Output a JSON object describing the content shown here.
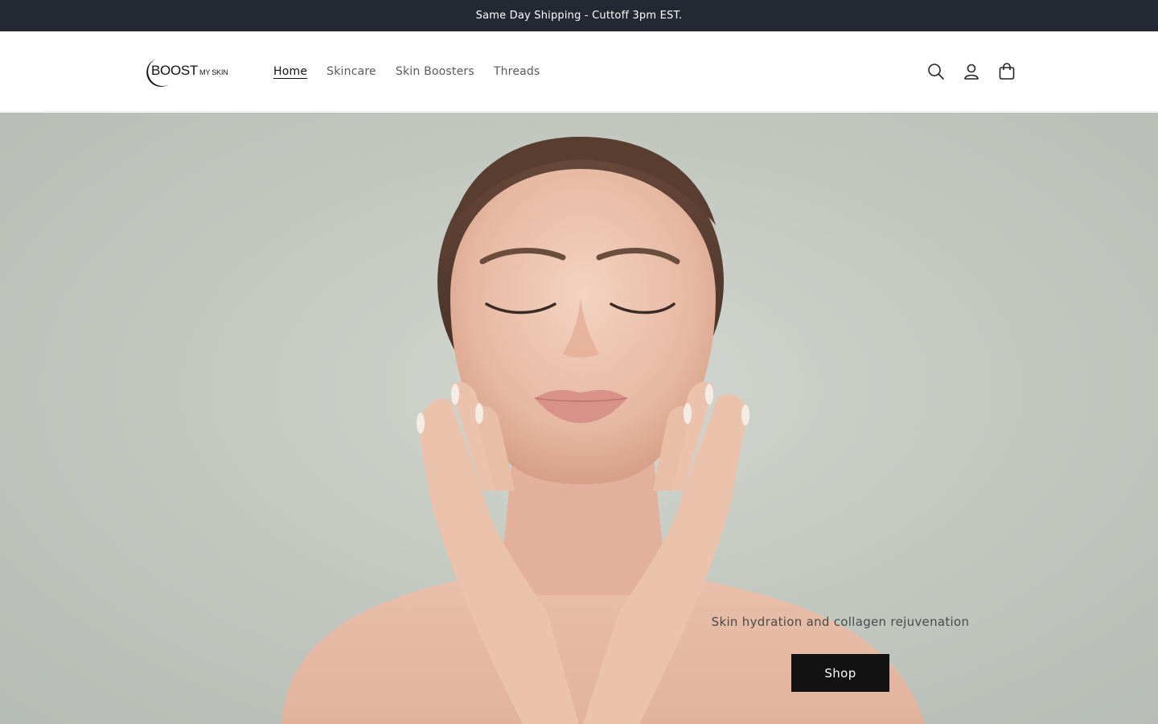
{
  "announcement": {
    "text": "Same Day Shipping - Cuttoff 3pm EST."
  },
  "brand": {
    "logo_main": "BOOST",
    "logo_sub": "MY SKIN"
  },
  "nav": {
    "items": [
      {
        "label": "Home",
        "active": true
      },
      {
        "label": "Skincare",
        "active": false
      },
      {
        "label": "Skin Boosters",
        "active": false
      },
      {
        "label": "Threads",
        "active": false
      }
    ]
  },
  "header_icons": [
    "search-icon",
    "account-icon",
    "cart-icon"
  ],
  "hero": {
    "image": "woman-touching-face-portrait",
    "caption": "Skin hydration and collagen rejuvenation",
    "button_label": "Shop"
  },
  "colors": {
    "announcement_bg": "#242833",
    "button_bg": "#121212",
    "hero_bg": "#c5cac3"
  }
}
